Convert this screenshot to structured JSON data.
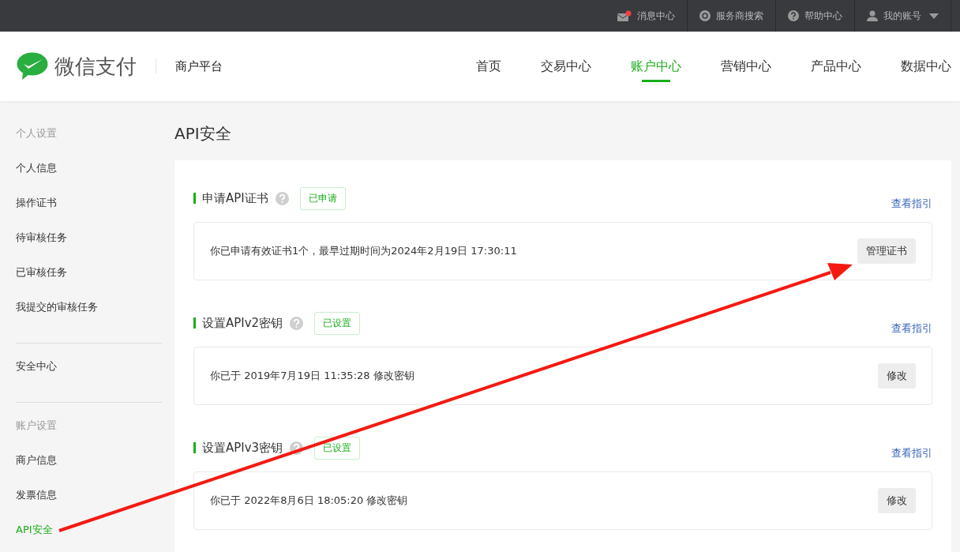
{
  "top_bar": {
    "items": [
      {
        "kind": "mail",
        "label": "消息中心"
      },
      {
        "kind": "search",
        "label": "服务商搜索"
      },
      {
        "kind": "help",
        "label": "帮助中心"
      },
      {
        "kind": "account",
        "label": "我的账号"
      }
    ]
  },
  "header": {
    "brand": "微信支付",
    "subtitle": "商户平台",
    "nav": [
      {
        "label": "首页",
        "selected": false
      },
      {
        "label": "交易中心",
        "selected": false
      },
      {
        "label": "账户中心",
        "selected": true
      },
      {
        "label": "营销中心",
        "selected": false
      },
      {
        "label": "产品中心",
        "selected": false
      },
      {
        "label": "数据中心",
        "selected": false
      }
    ]
  },
  "sidebar": {
    "groups": [
      {
        "heading": "个人设置",
        "items": [
          {
            "label": "个人信息",
            "selected": false
          },
          {
            "label": "操作证书",
            "selected": false
          },
          {
            "label": "待审核任务",
            "selected": false
          },
          {
            "label": "已审核任务",
            "selected": false
          },
          {
            "label": "我提交的审核任务",
            "selected": false
          }
        ]
      },
      {
        "items": [
          {
            "label": "安全中心",
            "selected": false
          }
        ]
      },
      {
        "heading": "账户设置",
        "items": [
          {
            "label": "商户信息",
            "selected": false
          },
          {
            "label": "发票信息",
            "selected": false
          },
          {
            "label": "API安全",
            "selected": true
          }
        ]
      }
    ]
  },
  "page_title": "API安全",
  "sections": [
    {
      "title": "申请API证书",
      "status": "已申请",
      "link": "查看指引",
      "message": "你已申请有效证书1个，最早过期时间为2024年2月19日 17:30:11",
      "button": "管理证书"
    },
    {
      "title": "设置APIv2密钥",
      "status": "已设置",
      "link": "查看指引",
      "message": "你已于 2019年7月19日 11:35:28 修改密钥",
      "button": "修改"
    },
    {
      "title": "设置APIv3密钥",
      "status": "已设置",
      "link": "查看指引",
      "message": "你已于 2022年8月6日 18:05:20 修改密钥",
      "button": "修改"
    }
  ]
}
